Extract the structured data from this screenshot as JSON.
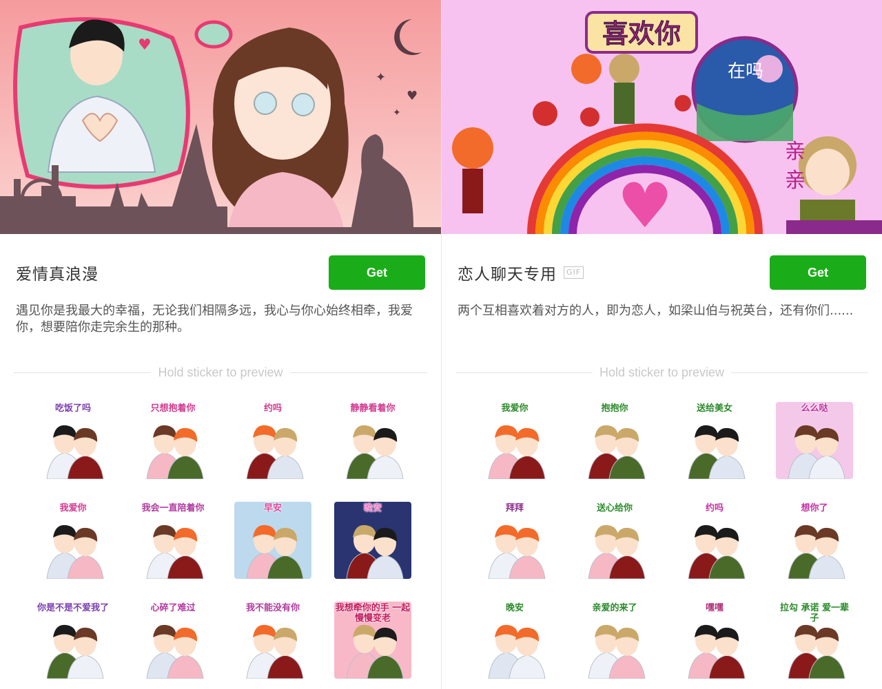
{
  "packs": [
    {
      "title": "爱情真浪漫",
      "badge": "",
      "get_label": "Get",
      "description": "遇见你是我最大的幸福，无论我们相隔多远，我心与你心始终相牵，我爱你，想要陪你走完余生的那种。",
      "hold_hint": "Hold sticker to preview",
      "banner_bg": "#f4a7a8",
      "stickers": [
        {
          "caption": "吃饭了吗",
          "bg": "#ffffff",
          "caption_color": "#7a3fb0"
        },
        {
          "caption": "只想抱着你",
          "bg": "#ffffff",
          "caption_color": "#d2398f"
        },
        {
          "caption": "约吗",
          "bg": "#ffffff",
          "caption_color": "#d2398f"
        },
        {
          "caption": "静静看着你",
          "bg": "#ffffff",
          "caption_color": "#d2398f"
        },
        {
          "caption": "我爱你",
          "bg": "#ffffff",
          "caption_color": "#d2398f"
        },
        {
          "caption": "我会一直陪着你",
          "bg": "#ffffff",
          "caption_color": "#b2399f"
        },
        {
          "caption": "早安",
          "bg": "#bcd9ee",
          "caption_color": "#e0469a"
        },
        {
          "caption": "晚安",
          "bg": "#2a3470",
          "caption_color": "#f07ac4"
        },
        {
          "caption": "你是不是不爱我了",
          "bg": "#ffffff",
          "caption_color": "#7a3fb0"
        },
        {
          "caption": "心碎了难过",
          "bg": "#ffffff",
          "caption_color": "#b2399f"
        },
        {
          "caption": "我不能没有你",
          "bg": "#ffffff",
          "caption_color": "#b2399f"
        },
        {
          "caption": "我想牵你的手 一起慢慢变老",
          "bg": "#f8b8c8",
          "caption_color": "#c2185b"
        }
      ]
    },
    {
      "title": "恋人聊天专用",
      "badge": "GIF",
      "get_label": "Get",
      "description": "两个互相喜欢着对方的人，即为恋人，如梁山伯与祝英台，还有你们......",
      "hold_hint": "Hold sticker to preview",
      "banner_bg": "#f7c2ef",
      "stickers": [
        {
          "caption": "我爱你",
          "bg": "#ffffff",
          "caption_color": "#2a8a2a"
        },
        {
          "caption": "抱抱你",
          "bg": "#ffffff",
          "caption_color": "#2a8a2a"
        },
        {
          "caption": "送给美女",
          "bg": "#ffffff",
          "caption_color": "#2a8a2a"
        },
        {
          "caption": "么么哒",
          "bg": "#f4c8e8",
          "caption_color": "#c030a0"
        },
        {
          "caption": "拜拜",
          "bg": "#ffffff",
          "caption_color": "#8a2a8a"
        },
        {
          "caption": "送心给你",
          "bg": "#ffffff",
          "caption_color": "#2a8a2a"
        },
        {
          "caption": "约吗",
          "bg": "#ffffff",
          "caption_color": "#c030a0"
        },
        {
          "caption": "想你了",
          "bg": "#ffffff",
          "caption_color": "#c030a0"
        },
        {
          "caption": "晚安",
          "bg": "#ffffff",
          "caption_color": "#2a8a2a"
        },
        {
          "caption": "亲爱的来了",
          "bg": "#ffffff",
          "caption_color": "#2a8a2a"
        },
        {
          "caption": "嘿嘿",
          "bg": "#ffffff",
          "caption_color": "#b0307a"
        },
        {
          "caption": "拉勾 承诺 爱一辈子",
          "bg": "#ffffff",
          "caption_color": "#2a8a2a"
        }
      ]
    }
  ]
}
